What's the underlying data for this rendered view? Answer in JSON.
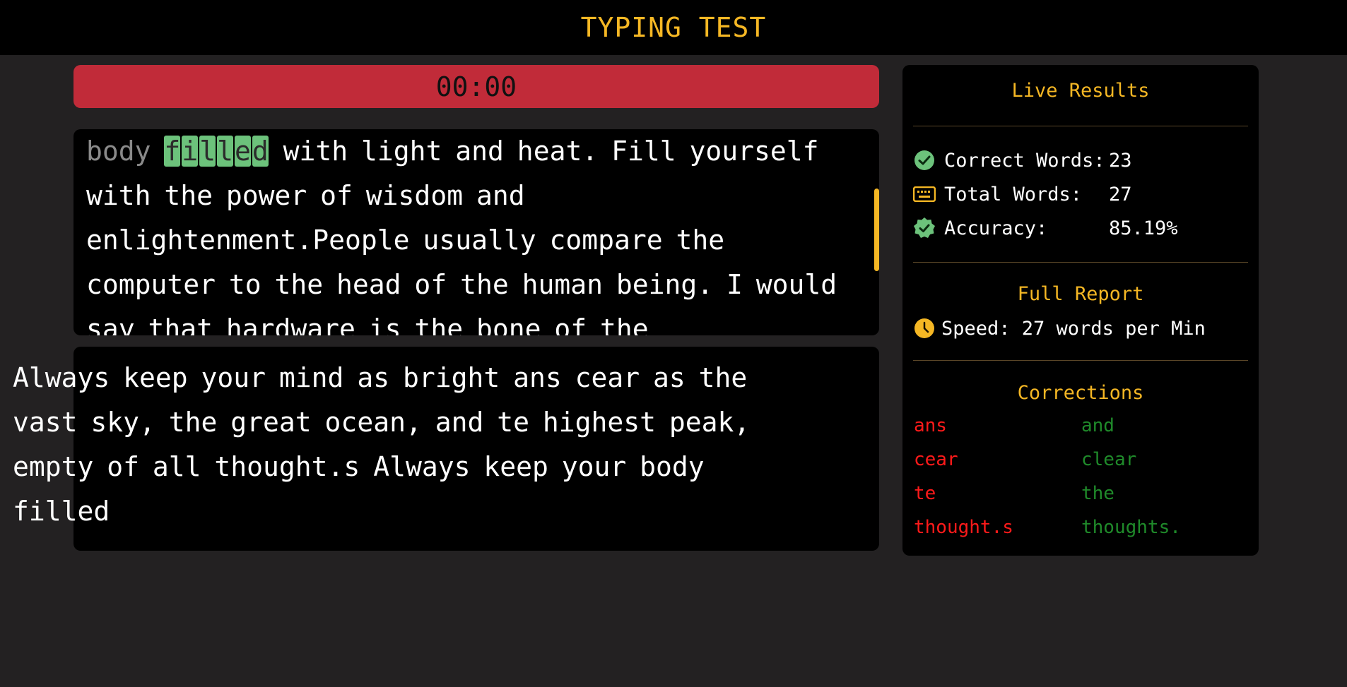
{
  "header": {
    "title": "TYPING TEST"
  },
  "timer": {
    "value": "00:00",
    "color": "#c12b39"
  },
  "reference_text": {
    "typed_before": "body",
    "current_word_letters": [
      "f",
      "i",
      "l",
      "l",
      "e",
      "d"
    ],
    "remaining": "with light and heat. Fill yourself with the power of wisdom and enlightenment.People usually compare the computer to the head of the human being. I would say that hardware is the bone of the"
  },
  "input": {
    "value": "Always keep your mind as bright ans cear as the vast sky, the great ocean, and te highest peak, empty of all thought.s Always keep your body filled"
  },
  "live_results": {
    "title": "Live Results",
    "correct_words_label": "Correct Words:",
    "correct_words_value": "23",
    "total_words_label": "Total Words:",
    "total_words_value": "27",
    "accuracy_label": "Accuracy:",
    "accuracy_value": "85.19%"
  },
  "full_report": {
    "title": "Full Report",
    "speed_text": "Speed: 27 words per Min"
  },
  "corrections": {
    "title": "Corrections",
    "items": [
      {
        "wrong": "ans",
        "right": "and"
      },
      {
        "wrong": "cear",
        "right": "clear"
      },
      {
        "wrong": "te",
        "right": "the"
      },
      {
        "wrong": "thought.s",
        "right": "thoughts."
      }
    ]
  },
  "colors": {
    "accent": "#f5b724",
    "correct": "#6cc27b",
    "error": "#ff1a1a",
    "fixed": "#1f8a2a"
  },
  "icons": {
    "correct_words": "check-circle-icon",
    "total_words": "keyboard-icon",
    "accuracy": "verified-badge-icon",
    "speed": "clock-icon"
  }
}
